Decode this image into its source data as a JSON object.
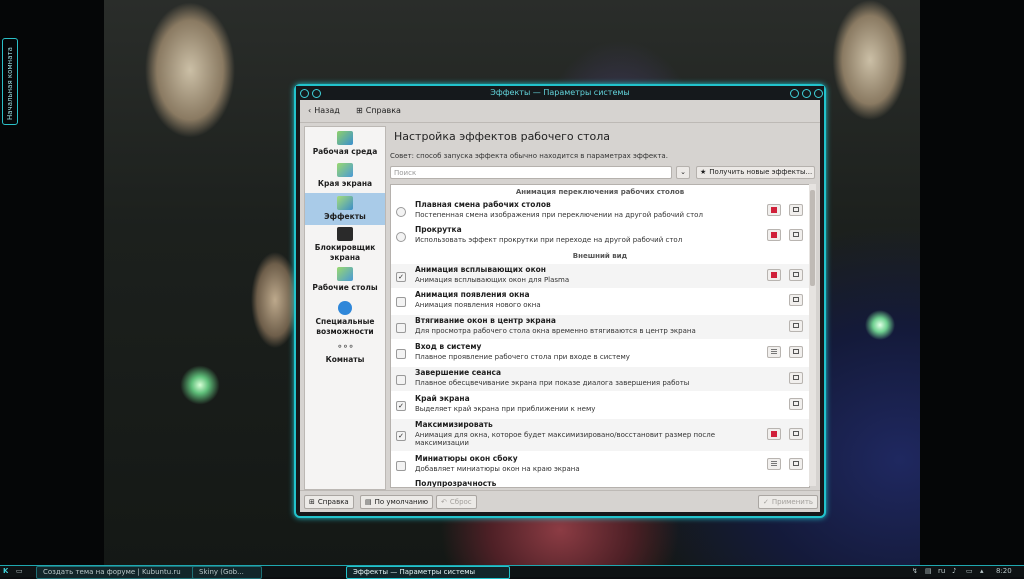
{
  "desktop": {
    "activity_label": "Начальная комната"
  },
  "window": {
    "title": "Эффекты — Параметры системы"
  },
  "toolbar": {
    "back_label": "Назад",
    "help_label": "Справка"
  },
  "sidebar": {
    "items": [
      {
        "label": "Рабочая среда",
        "icon": "workspace-icon"
      },
      {
        "label": "Края экрана",
        "icon": "screen-edges-icon"
      },
      {
        "label": "Эффекты",
        "icon": "effects-icon",
        "selected": true
      },
      {
        "label": "Блокировщик экрана",
        "icon": "screen-locker-icon"
      },
      {
        "label": "Рабочие столы",
        "icon": "desktops-icon"
      },
      {
        "label": "Специальные возможности",
        "icon": "accessibility-icon"
      },
      {
        "label": "Комнаты",
        "icon": "activities-icon"
      }
    ]
  },
  "main": {
    "heading": "Настройка эффектов рабочего стола",
    "hint": "Совет: способ запуска эффекта обычно находится в параметрах эффекта.",
    "search_placeholder": "Поиск",
    "get_new_label": "Получить новые эффекты...",
    "groups": [
      {
        "label": "Анимация переключения рабочих столов"
      },
      {
        "label": "Внешний вид"
      }
    ],
    "effects": [
      {
        "name": "Плавная смена рабочих столов",
        "desc": "Постепенная смена изображения при переключении на другой рабочий стол",
        "checked": false,
        "control": "radio",
        "video": true,
        "config": false
      },
      {
        "name": "Прокрутка",
        "desc": "Использовать эффект прокрутки при переходе на другой рабочий стол",
        "checked": false,
        "control": "radio",
        "video": true,
        "config": false
      },
      {
        "name": "Анимация всплывающих окон",
        "desc": "Анимация всплывающих окон для Plasma",
        "checked": true,
        "control": "checkbox",
        "video": true,
        "config": false
      },
      {
        "name": "Анимация появления окна",
        "desc": "Анимация появления нового окна",
        "checked": false,
        "control": "checkbox",
        "video": false,
        "config": false
      },
      {
        "name": "Втягивание окон в центр экрана",
        "desc": "Для просмотра рабочего стола окна временно втягиваются в центр экрана",
        "checked": false,
        "control": "checkbox",
        "video": false,
        "config": false
      },
      {
        "name": "Вход в систему",
        "desc": "Плавное проявление рабочего стола при входе в систему",
        "checked": false,
        "control": "checkbox",
        "video": false,
        "config": true
      },
      {
        "name": "Завершение сеанса",
        "desc": "Плавное обесцвечивание экрана при показе диалога завершения работы",
        "checked": false,
        "control": "checkbox",
        "video": false,
        "config": false
      },
      {
        "name": "Край экрана",
        "desc": "Выделяет край экрана при приближении к нему",
        "checked": true,
        "control": "checkbox",
        "video": false,
        "config": false
      },
      {
        "name": "Максимизировать",
        "desc": "Анимация для окна, которое будет максимизировано/восстановит размер после максимизации",
        "checked": true,
        "control": "checkbox",
        "video": true,
        "config": false
      },
      {
        "name": "Миниатюры окон сбоку",
        "desc": "Добавляет миниатюры окон на краю экрана",
        "checked": false,
        "control": "checkbox",
        "video": false,
        "config": true
      },
      {
        "name": "Полупрозрачность",
        "desc": "",
        "checked": false,
        "control": "checkbox",
        "video": false,
        "config": false
      }
    ]
  },
  "footer": {
    "help_label": "Справка",
    "defaults_label": "По умолчанию",
    "reset_label": "Сброс",
    "apply_label": "Применить"
  },
  "taskbar": {
    "tasks": [
      "Создать тема на форуме | Kubuntu.ru",
      "Skiny (Gob...",
      "Эффекты — Параметры системы"
    ],
    "layout": "ru",
    "clock": "8:20"
  },
  "colors": {
    "accent": "#22c3cc",
    "selection": "#a9cbe8",
    "video_button": "#d0203a"
  }
}
